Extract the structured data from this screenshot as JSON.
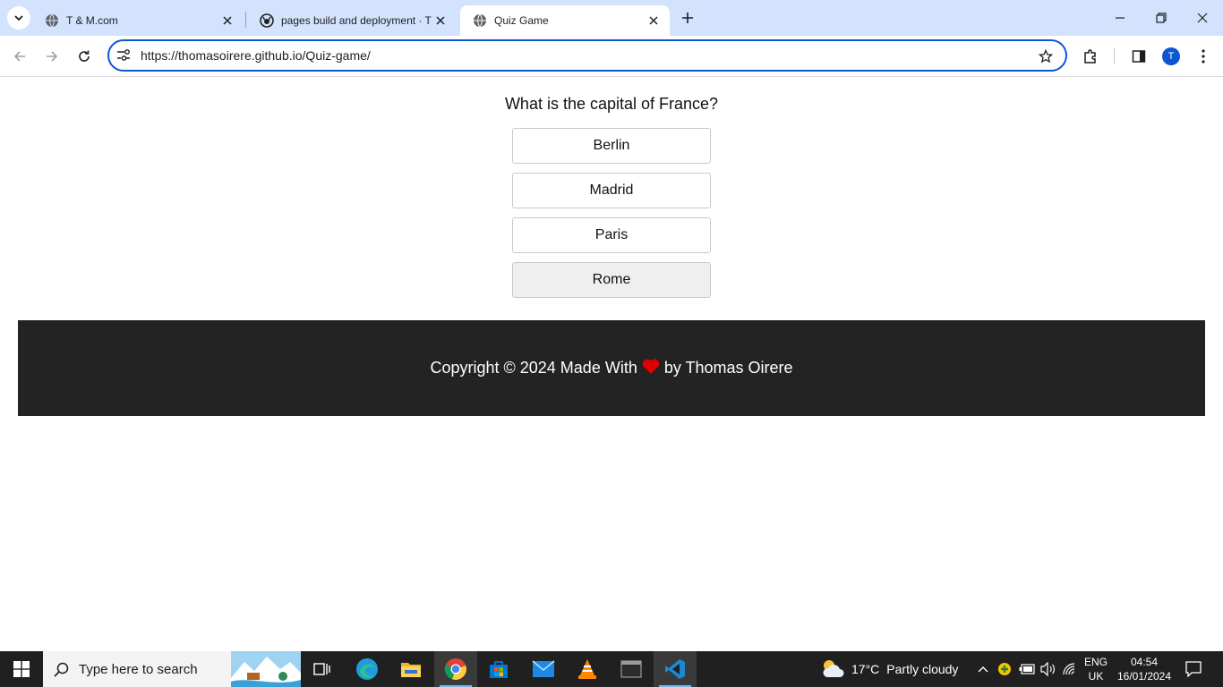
{
  "browser": {
    "tabs": [
      {
        "title": "T & M.com",
        "favicon": "globe-icon",
        "active": false
      },
      {
        "title": "pages build and deployment · T",
        "favicon": "github-icon",
        "active": false
      },
      {
        "title": "Quiz Game",
        "favicon": "globe-icon",
        "active": true
      }
    ],
    "url": "https://thomasoirere.github.io/Quiz-game/",
    "profile_initial": "T",
    "accent_color": "#0b57d0",
    "tabbar_color": "#d3e3fd"
  },
  "quiz": {
    "question": "What is the capital of France?",
    "answers": [
      "Berlin",
      "Madrid",
      "Paris",
      "Rome"
    ],
    "hovered_answer": "Rome"
  },
  "footer": {
    "text_before": "Copyright © 2024 Made With",
    "heart_icon": "heart-icon",
    "heart_color": "#e00000",
    "text_after": "by Thomas Oirere",
    "background": "#232323"
  },
  "taskbar": {
    "search_placeholder": "Type here to search",
    "weather": {
      "temperature": "17°C",
      "condition": "Partly cloudy"
    },
    "language": {
      "code": "ENG",
      "region": "UK"
    },
    "time": "04:54",
    "date": "16/01/2024",
    "pinned": [
      "task-view-icon",
      "edge-icon",
      "file-explorer-icon",
      "chrome-icon",
      "microsoft-store-icon",
      "mail-icon",
      "vlc-icon",
      "terminal-icon",
      "vscode-icon"
    ]
  }
}
